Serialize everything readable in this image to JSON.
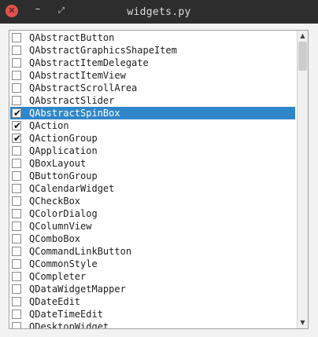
{
  "window": {
    "title": "widgets.py",
    "close_glyph": "✕",
    "minimize_glyph": "–",
    "maximize_glyph": "⤢"
  },
  "colors": {
    "titlebar": "#2d2d2d",
    "close_button": "#e0524d",
    "selection": "#2f86c9"
  },
  "list": {
    "items": [
      {
        "label": "QAbstractButton",
        "checked": false,
        "selected": false
      },
      {
        "label": "QAbstractGraphicsShapeItem",
        "checked": false,
        "selected": false
      },
      {
        "label": "QAbstractItemDelegate",
        "checked": false,
        "selected": false
      },
      {
        "label": "QAbstractItemView",
        "checked": false,
        "selected": false
      },
      {
        "label": "QAbstractScrollArea",
        "checked": false,
        "selected": false
      },
      {
        "label": "QAbstractSlider",
        "checked": false,
        "selected": false
      },
      {
        "label": "QAbstractSpinBox",
        "checked": true,
        "selected": true
      },
      {
        "label": "QAction",
        "checked": true,
        "selected": false
      },
      {
        "label": "QActionGroup",
        "checked": true,
        "selected": false
      },
      {
        "label": "QApplication",
        "checked": false,
        "selected": false
      },
      {
        "label": "QBoxLayout",
        "checked": false,
        "selected": false
      },
      {
        "label": "QButtonGroup",
        "checked": false,
        "selected": false
      },
      {
        "label": "QCalendarWidget",
        "checked": false,
        "selected": false
      },
      {
        "label": "QCheckBox",
        "checked": false,
        "selected": false
      },
      {
        "label": "QColorDialog",
        "checked": false,
        "selected": false
      },
      {
        "label": "QColumnView",
        "checked": false,
        "selected": false
      },
      {
        "label": "QComboBox",
        "checked": false,
        "selected": false
      },
      {
        "label": "QCommandLinkButton",
        "checked": false,
        "selected": false
      },
      {
        "label": "QCommonStyle",
        "checked": false,
        "selected": false
      },
      {
        "label": "QCompleter",
        "checked": false,
        "selected": false
      },
      {
        "label": "QDataWidgetMapper",
        "checked": false,
        "selected": false
      },
      {
        "label": "QDateEdit",
        "checked": false,
        "selected": false
      },
      {
        "label": "QDateTimeEdit",
        "checked": false,
        "selected": false
      },
      {
        "label": "QDesktopWidget",
        "checked": false,
        "selected": false
      }
    ],
    "check_glyph": "✔"
  },
  "scrollbar": {
    "up_glyph": "▲",
    "down_glyph": "▼",
    "scroll_fraction": 0.0
  }
}
